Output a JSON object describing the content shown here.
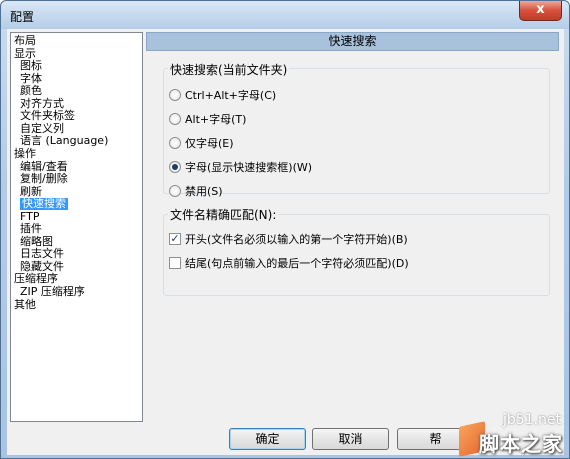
{
  "window": {
    "title": "配置",
    "close_glyph": "x"
  },
  "tree": {
    "items": [
      {
        "label": "布局",
        "indent": 0
      },
      {
        "label": "显示",
        "indent": 0
      },
      {
        "label": "图标",
        "indent": 1
      },
      {
        "label": "字体",
        "indent": 1
      },
      {
        "label": "颜色",
        "indent": 1
      },
      {
        "label": "对齐方式",
        "indent": 1
      },
      {
        "label": "文件夹标签",
        "indent": 1
      },
      {
        "label": "自定义列",
        "indent": 1
      },
      {
        "label": "语言 (Language)",
        "indent": 1
      },
      {
        "label": "操作",
        "indent": 0
      },
      {
        "label": "编辑/查看",
        "indent": 1
      },
      {
        "label": "复制/删除",
        "indent": 1
      },
      {
        "label": "刷新",
        "indent": 1
      },
      {
        "label": "快速搜索",
        "indent": 1,
        "selected": true
      },
      {
        "label": "FTP",
        "indent": 1
      },
      {
        "label": "插件",
        "indent": 1
      },
      {
        "label": "缩略图",
        "indent": 1
      },
      {
        "label": "日志文件",
        "indent": 1
      },
      {
        "label": "隐藏文件",
        "indent": 1
      },
      {
        "label": "压缩程序",
        "indent": 0
      },
      {
        "label": "ZIP 压缩程序",
        "indent": 1
      },
      {
        "label": "其他",
        "indent": 0
      }
    ]
  },
  "panel": {
    "header": "快速搜索",
    "quicksearch_group": {
      "label": "快速搜索(当前文件夹)",
      "options": [
        {
          "label": "Ctrl+Alt+字母(C)",
          "selected": false
        },
        {
          "label": "Alt+字母(T)",
          "selected": false
        },
        {
          "label": "仅字母(E)",
          "selected": false
        },
        {
          "label": "字母(显示快速搜索框)(W)",
          "selected": true
        },
        {
          "label": "禁用(S)",
          "selected": false
        }
      ]
    },
    "match_group": {
      "label": "文件名精确匹配(N):",
      "options": [
        {
          "label": "开头(文件名必须以输入的第一个字符开始)(B)",
          "checked": true
        },
        {
          "label": "结尾(句点前输入的最后一个字符必须匹配)(D)",
          "checked": false
        }
      ]
    }
  },
  "buttons": {
    "ok": "确定",
    "cancel": "取消",
    "help": "帮"
  },
  "watermark": {
    "site": "jb51.net",
    "name": "脚本之家"
  }
}
